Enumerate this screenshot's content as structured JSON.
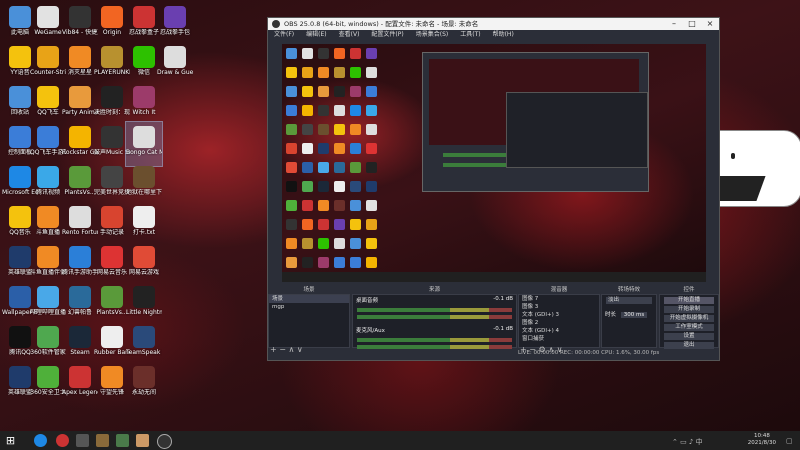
{
  "desktop": {
    "icons": [
      {
        "label": "此电脑",
        "color": "#4a90d9"
      },
      {
        "label": "WeGame",
        "color": "#e2e2e2"
      },
      {
        "label": "Vib84 - 快捷方式",
        "color": "#333"
      },
      {
        "label": "Origin",
        "color": "#f26522"
      },
      {
        "label": "忍战拳盒子",
        "color": "#c33"
      },
      {
        "label": "忍战拳手包",
        "color": "#6a3fb0"
      },
      {
        "label": "YY语音",
        "color": "#f4c20d"
      },
      {
        "label": "Counter-Strike Global Off...",
        "color": "#e8a317"
      },
      {
        "label": "消灭星星",
        "color": "#f08a24"
      },
      {
        "label": "PLAYERUNKNOWN'S BATTLEGR...",
        "color": "#b8912f"
      },
      {
        "label": "微信",
        "color": "#2dc100"
      },
      {
        "label": "Draw & Guess",
        "color": "#ddd"
      },
      {
        "label": "回收站",
        "color": "#4a90d9"
      },
      {
        "label": "QQ飞车",
        "color": "#f4c20d"
      },
      {
        "label": "Party Animals",
        "color": "#e89a3c"
      },
      {
        "label": "决胜时刻：现代战争",
        "color": "#222"
      },
      {
        "label": "Witch It",
        "color": "#9c3b6a"
      },
      {
        "label": "控制面板",
        "color": "#3b7dd8"
      },
      {
        "label": "QQ飞车手游工具",
        "color": "#3b7dd8"
      },
      {
        "label": "Rockstar Games...",
        "color": "#f4b400"
      },
      {
        "label": "鼓声Music Sour...",
        "color": "#333"
      },
      {
        "label": "Bongo Cat Mver",
        "color": "#ddd"
      },
      {
        "label": "Microsoft Edge",
        "color": "#1e88e5"
      },
      {
        "label": "腾讯视频",
        "color": "#3aa8e8"
      },
      {
        "label": "PlantsVs...",
        "color": "#5a9a3a"
      },
      {
        "label": "完美世界竞技平台",
        "color": "#444"
      },
      {
        "label": "地狱在哪里下载",
        "color": "#6b4f2e"
      },
      {
        "label": "QQ音乐",
        "color": "#f4c20d"
      },
      {
        "label": "斗鱼直播",
        "color": "#f08a24"
      },
      {
        "label": "Rento Fortune",
        "color": "#ddd"
      },
      {
        "label": "手动记录",
        "color": "#d8442f"
      },
      {
        "label": "打卡.txt",
        "color": "#eee"
      },
      {
        "label": "英雄联盟",
        "color": "#1f3b6b"
      },
      {
        "label": "斗鱼直播伴侣",
        "color": "#f08a24"
      },
      {
        "label": "腾讯手游助手",
        "color": "#2b7fd8"
      },
      {
        "label": "网易云音乐",
        "color": "#d33"
      },
      {
        "label": "网易云游戏",
        "color": "#e04b36"
      },
      {
        "label": "Wallpaper Engine...",
        "color": "#2b5fa8"
      },
      {
        "label": "哔哩哔哩直播姬",
        "color": "#49a8e8"
      },
      {
        "label": "幻兽帕鲁",
        "color": "#2a6a9a"
      },
      {
        "label": "PlantsVs...",
        "color": "#5a9a3a"
      },
      {
        "label": "Little Nightmares",
        "color": "#222"
      },
      {
        "label": "腾讯QQ",
        "color": "#111"
      },
      {
        "label": "360软件管家",
        "color": "#4fa84f"
      },
      {
        "label": "Steam",
        "color": "#1b2838"
      },
      {
        "label": "Rubber Bandit...",
        "color": "#eee"
      },
      {
        "label": "TeamSpeak 3",
        "color": "#2a4a7a"
      },
      {
        "label": "英雄联盟",
        "color": "#1f3b6b"
      },
      {
        "label": "360安全卫士",
        "color": "#4fb03a"
      },
      {
        "label": "Apex Legends",
        "color": "#c33"
      },
      {
        "label": "守望先锋",
        "color": "#f08a24"
      },
      {
        "label": "永劫无间",
        "color": "#6b2f2a"
      }
    ]
  },
  "obs": {
    "title": "OBS 25.0.8 (64-bit, windows) - 配置文件: 未命名 - 场景: 未命名",
    "menu": [
      "文件(F)",
      "编辑(E)",
      "查看(V)",
      "配置文件(P)",
      "场景集合(S)",
      "工具(T)",
      "帮助(H)"
    ],
    "panels": {
      "scenes": "场景",
      "sources": "来源",
      "mixer": "混音器",
      "transitions": "转场特效",
      "controls": "控件"
    },
    "scenes": [
      "场景",
      "mgp"
    ],
    "sources": [
      "图像 7",
      "图像 3",
      "文本 (GDI+) 3",
      "图像 2",
      "文本 (GDI+) 4",
      "窗口捕获"
    ],
    "mixer": [
      {
        "name": "桌面音频",
        "db": "-0.1 dB"
      },
      {
        "name": "麦克风/Aux",
        "db": "-0.1 dB"
      }
    ],
    "transition": {
      "type": "淡出",
      "duration_label": "时长",
      "duration": "300 ms"
    },
    "controls": [
      "开始直播",
      "开始录制",
      "开始虚拟摄像机",
      "工作室模式",
      "设置",
      "退出"
    ],
    "status": "LIVE: 00:00:00    REC: 00:00:00    CPU: 1.6%, 30.00 fps"
  },
  "taskbar": {
    "time": "10:48",
    "date": "2021/8/30"
  }
}
